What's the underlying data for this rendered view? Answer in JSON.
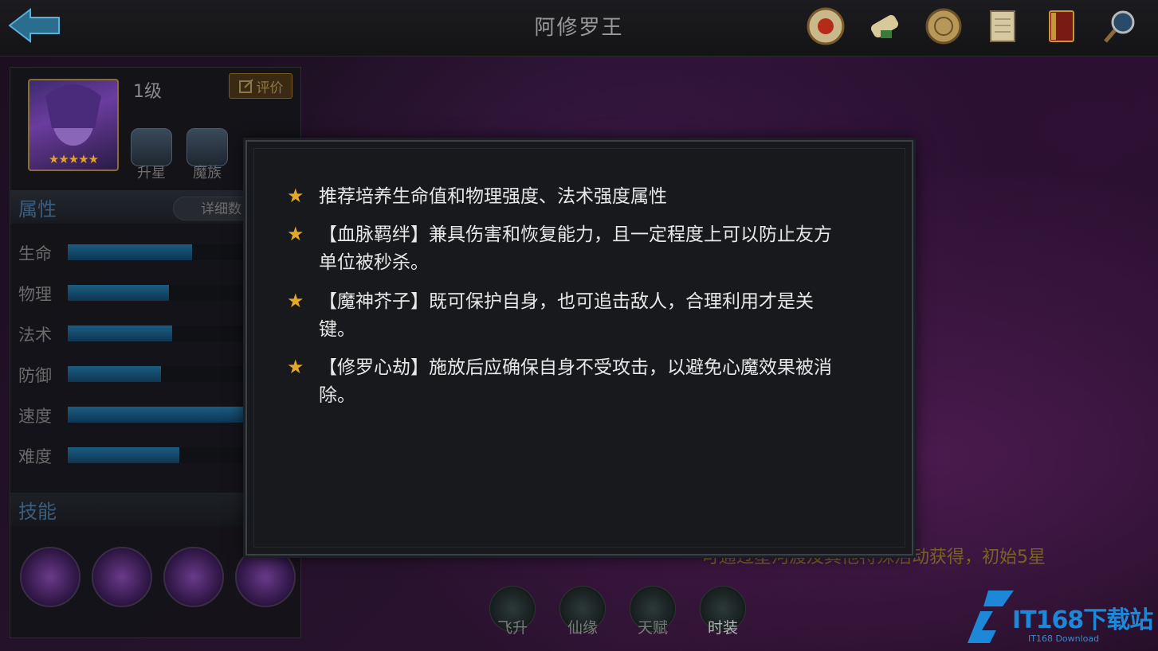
{
  "header": {
    "title": "阿修罗王"
  },
  "top_icons": [
    "scroll-seal-icon",
    "map-scroll-icon",
    "coin-icon",
    "document-icon",
    "book-icon",
    "magnifier-icon"
  ],
  "hero": {
    "level": "1级",
    "star_count": 5,
    "stars": "★★★★★",
    "evaluate_label": "评价",
    "badges": [
      {
        "label": "升星"
      },
      {
        "label": "魔族"
      }
    ]
  },
  "attributes": {
    "title": "属性",
    "detail_label": "详细数",
    "rows": [
      {
        "label": "生命",
        "value": 0.68
      },
      {
        "label": "物理",
        "value": 0.55
      },
      {
        "label": "法术",
        "value": 0.57
      },
      {
        "label": "防御",
        "value": 0.51
      },
      {
        "label": "速度",
        "value": 0.97
      },
      {
        "label": "难度",
        "value": 0.61
      }
    ]
  },
  "skills": {
    "title": "技能"
  },
  "bottom_tabs": [
    {
      "label": "飞升"
    },
    {
      "label": "仙缘"
    },
    {
      "label": "天赋"
    },
    {
      "label": "时装"
    }
  ],
  "footer_note": "可通过星河渡及其他特殊活动获得，初始5星",
  "popup": {
    "tips": [
      {
        "text": "推荐培养生命值和物理强度、法术强度属性"
      },
      {
        "text": "【血脉羁绊】兼具伤害和恢复能力，且一定程度上可以防止友方单位被秒杀。"
      },
      {
        "text": "【魔神芥子】既可保护自身，也可追击敌人，合理利用才是关键。"
      },
      {
        "text": "【修罗心劫】施放后应确保自身不受攻击，以避免心魔效果被消除。"
      }
    ]
  },
  "watermark": {
    "brand": "IT168下载站",
    "sub": "IT168 Download"
  },
  "colors": {
    "accent_blue": "#1b5c82",
    "star_gold": "#e5a729",
    "eval_gold": "#8c7848"
  }
}
